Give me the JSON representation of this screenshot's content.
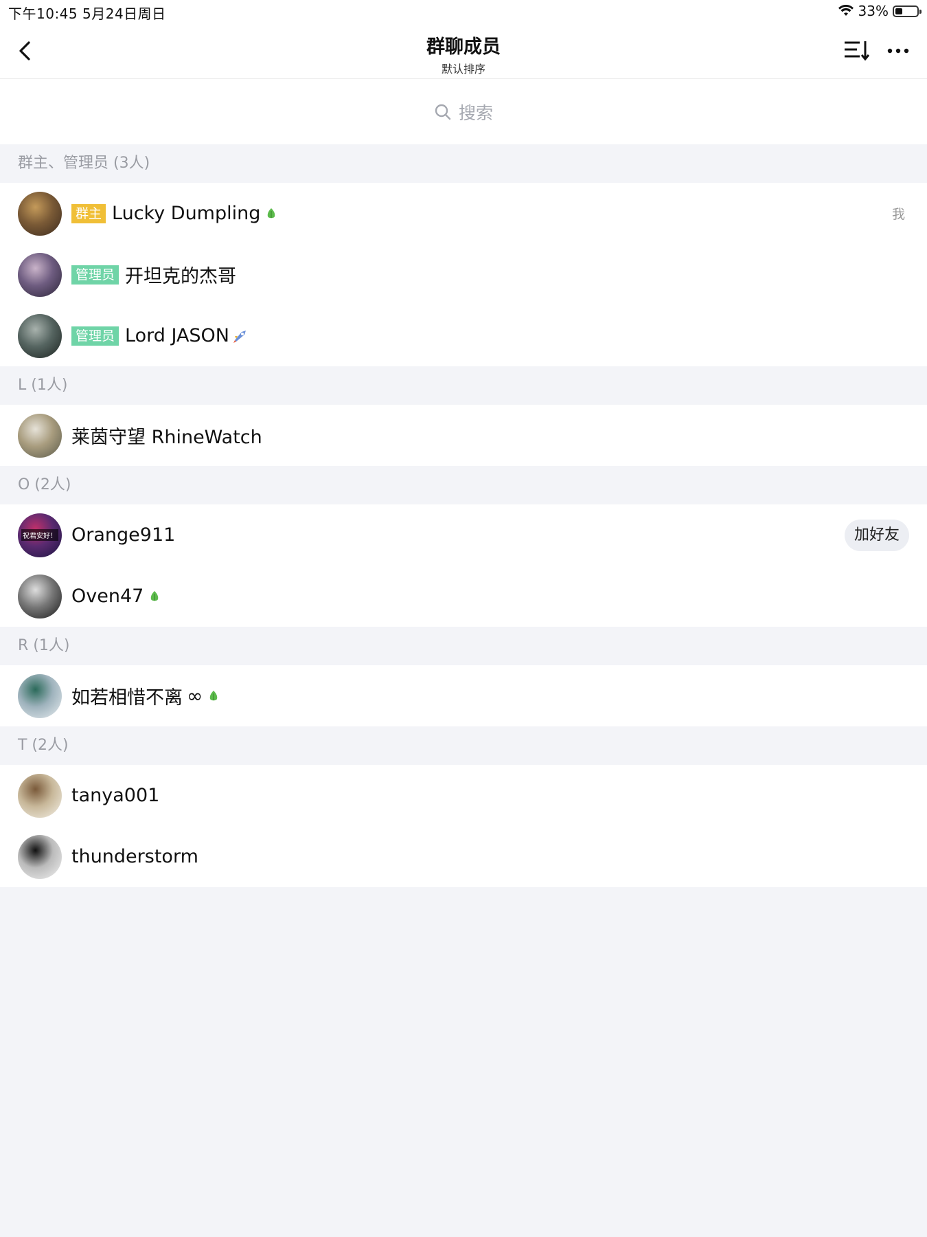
{
  "status": {
    "time": "下午10:45   5月24日周日",
    "battery": "33%",
    "battery_level": 0.33
  },
  "nav": {
    "title": "群聊成员",
    "subtitle": "默认排序",
    "icons": [
      "back-chevron-icon",
      "sort-icon",
      "more-icon"
    ]
  },
  "search": {
    "placeholder": "搜索",
    "icon": "search-icon"
  },
  "sections": [
    {
      "header": "群主、管理员 (3人)",
      "members": [
        {
          "badge": "群主",
          "badge_type": "owner",
          "name": "Lucky Dumpling",
          "leaf": true,
          "right_label": "我",
          "avatar_colors": [
            "#3b2a1e",
            "#7a5a36",
            "#c49a5a"
          ]
        },
        {
          "badge": "管理员",
          "badge_type": "admin",
          "name": "开坦克的杰哥",
          "avatar_colors": [
            "#2c2538",
            "#6e5c80",
            "#c9b3c9"
          ]
        },
        {
          "badge": "管理员",
          "badge_type": "admin",
          "name": "Lord JASON",
          "rocket": true,
          "avatar_colors": [
            "#1c2320",
            "#556460",
            "#a8b2ad"
          ]
        }
      ]
    },
    {
      "header": "L (1人)",
      "members": [
        {
          "name": "莱茵守望 RhineWatch",
          "avatar_colors": [
            "#5a5a4a",
            "#a89c7e",
            "#e6e2d8"
          ]
        }
      ]
    },
    {
      "header": "O (2人)",
      "members": [
        {
          "name": "Orange911",
          "button": "加好友",
          "avatar_colors": [
            "#1a1440",
            "#5a2a70",
            "#c0306a"
          ],
          "avatar_text": "祝君安好！"
        },
        {
          "name": "Oven47",
          "leaf": true,
          "avatar_colors": [
            "#1a1a1a",
            "#777",
            "#ddd"
          ]
        }
      ]
    },
    {
      "header": "R (1人)",
      "members": [
        {
          "name": "如若相惜不离",
          "inf": "∞",
          "leaf": true,
          "avatar_colors": [
            "#e8edf0",
            "#9fb3bd",
            "#2b6a5a"
          ]
        }
      ]
    },
    {
      "header": "T (2人)",
      "members": [
        {
          "name": "tanya001",
          "avatar_colors": [
            "#f4f1e8",
            "#c8b89a",
            "#7a5a3a"
          ]
        },
        {
          "name": "thunderstorm",
          "avatar_colors": [
            "#f2f2f2",
            "#bbb",
            "#111"
          ]
        }
      ]
    }
  ]
}
